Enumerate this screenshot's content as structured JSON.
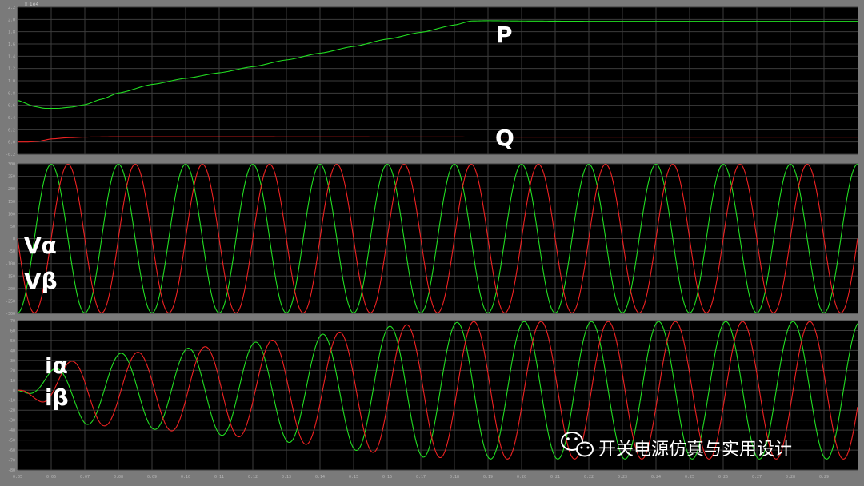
{
  "chart_data": [
    {
      "type": "line",
      "name_on_chart": [
        "P",
        "Q"
      ],
      "exponent_label": "× 1e4",
      "y_ticks": [
        "-0.2",
        "0.0",
        "0.2",
        "0.4",
        "0.6",
        "0.8",
        "1.0",
        "1.2",
        "1.4",
        "1.6",
        "1.8",
        "2.0",
        "2.2"
      ],
      "ylim": [
        -0.2,
        2.2
      ],
      "xlim": [
        0.05,
        0.3
      ],
      "grid": true,
      "series": [
        {
          "name": "P",
          "color": "#22dd22",
          "x": [
            0.05,
            0.055,
            0.058,
            0.062,
            0.066,
            0.07,
            0.075,
            0.08,
            0.09,
            0.1,
            0.11,
            0.12,
            0.13,
            0.14,
            0.15,
            0.16,
            0.17,
            0.18,
            0.185,
            0.19,
            0.2,
            0.22,
            0.25,
            0.3
          ],
          "y": [
            0.68,
            0.58,
            0.55,
            0.55,
            0.57,
            0.61,
            0.7,
            0.8,
            0.94,
            1.04,
            1.13,
            1.23,
            1.34,
            1.45,
            1.56,
            1.68,
            1.79,
            1.91,
            1.975,
            1.98,
            1.975,
            1.97,
            1.97,
            1.97
          ]
        },
        {
          "name": "Q",
          "color": "#ee2222",
          "x": [
            0.05,
            0.053,
            0.056,
            0.06,
            0.065,
            0.07,
            0.08,
            0.1,
            0.2,
            0.3
          ],
          "y": [
            0.0,
            0.0,
            0.01,
            0.05,
            0.07,
            0.08,
            0.085,
            0.085,
            0.08,
            0.08
          ]
        }
      ]
    },
    {
      "type": "line",
      "name_on_chart": [
        "Vα",
        "Vβ"
      ],
      "y_ticks": [
        "300",
        "250",
        "200",
        "150",
        "100",
        "50",
        "0",
        "-50",
        "-100",
        "-150",
        "-200",
        "-250",
        "-300"
      ],
      "ylim": [
        -300,
        300
      ],
      "xlim": [
        0.05,
        0.3
      ],
      "grid": true,
      "frequency_hz": 50,
      "amplitude": 298,
      "series": [
        {
          "name": "Vα",
          "color": "#22dd22",
          "phase_deg": 90
        },
        {
          "name": "Vβ",
          "color": "#ee2222",
          "phase_deg": 0
        }
      ]
    },
    {
      "type": "line",
      "name_on_chart": [
        "iα",
        "iβ"
      ],
      "y_ticks": [
        "70",
        "60",
        "50",
        "40",
        "30",
        "20",
        "10",
        "0",
        "-10",
        "-20",
        "-30",
        "-40",
        "-50",
        "-60",
        "-70",
        "-80"
      ],
      "ylim": [
        -80,
        70
      ],
      "xlim": [
        0.05,
        0.3
      ],
      "grid": true,
      "frequency_hz": 50,
      "envelope": {
        "t": [
          0.05,
          0.052,
          0.056,
          0.06,
          0.065,
          0.07,
          0.08,
          0.09,
          0.1,
          0.11,
          0.12,
          0.13,
          0.14,
          0.15,
          0.16,
          0.17,
          0.18,
          0.185,
          0.19,
          0.3
        ],
        "amplitude": [
          0,
          2,
          10,
          20,
          28,
          34,
          37,
          39,
          42,
          45,
          48,
          52,
          56,
          60,
          64,
          67,
          68,
          69,
          69,
          69
        ]
      },
      "series": [
        {
          "name": "iα",
          "color": "#22dd22",
          "phase_deg": 76
        },
        {
          "name": "iβ",
          "color": "#ee2222",
          "phase_deg": -14
        }
      ]
    }
  ],
  "x_ticks": [
    "0.05",
    "0.06",
    "0.07",
    "0.08",
    "0.09",
    "0.10",
    "0.11",
    "0.12",
    "0.13",
    "0.14",
    "0.15",
    "0.16",
    "0.17",
    "0.18",
    "0.19",
    "0.20",
    "0.21",
    "0.22",
    "0.23",
    "0.24",
    "0.25",
    "0.26",
    "0.27",
    "0.28",
    "0.29"
  ],
  "watermark": {
    "text": "开关电源仿真与实用设计",
    "icon": "wechat-icon"
  },
  "colors": {
    "background": "#000000",
    "frame": "#7a7a7a",
    "grid": "#3c3c3c",
    "green": "#22dd22",
    "red": "#ee2222"
  }
}
